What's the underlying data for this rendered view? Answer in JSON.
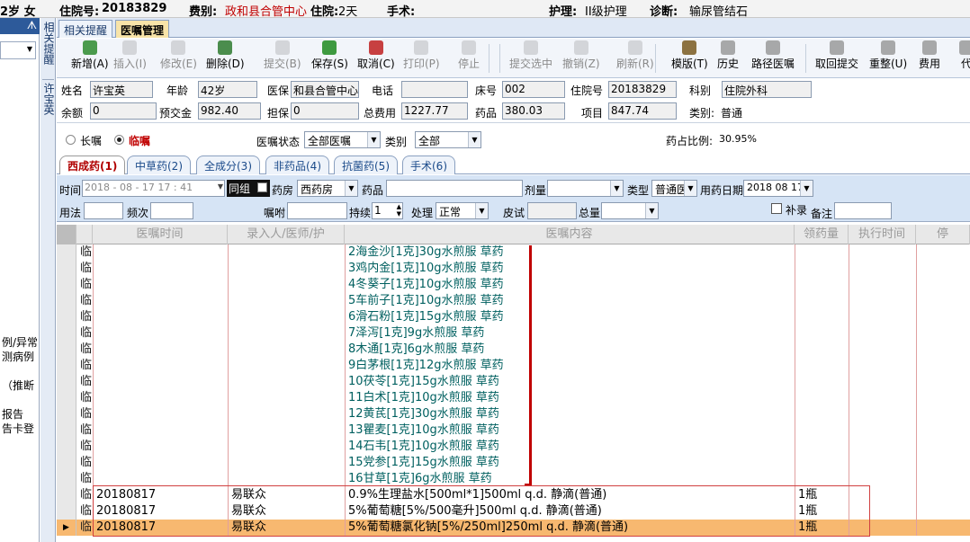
{
  "header": {
    "age_sex": "2岁  女",
    "admission_label": "住院号:",
    "admission_no": "20183829",
    "fee_label": "费别:",
    "fee_value": "政和县合管中心",
    "stay_label": "住院:",
    "stay_value": "2天",
    "surgery_label": "手术:",
    "nursing_label": "护理:",
    "nursing_value": "II级护理",
    "diag_label": "诊断:",
    "diag_value": "输尿管结石"
  },
  "left_panel": {
    "pin": "ᗑ",
    "items": [
      "例/异常",
      "测病例",
      "（推断",
      "报告",
      "告卡登"
    ]
  },
  "vertical_tabs": [
    "相关提醒",
    "许宝英"
  ],
  "top_tabs": [
    "相关提醒",
    "医嘱管理"
  ],
  "toolbar": [
    {
      "label": "新增(A)",
      "icon": "add-icon",
      "color": "#2e8b2e",
      "enabled": true
    },
    {
      "label": "插入(I)",
      "icon": "insert-icon",
      "color": "#9a9a9a",
      "enabled": false
    },
    {
      "label": "修改(E)",
      "icon": "edit-icon",
      "color": "#9a9a9a",
      "enabled": false
    },
    {
      "label": "删除(D)",
      "icon": "delete-icon",
      "color": "#2e7a2e",
      "enabled": true
    },
    {
      "label": "提交(B)",
      "icon": "submit-icon",
      "color": "#9a9a9a",
      "enabled": false
    },
    {
      "label": "保存(S)",
      "icon": "save-icon",
      "color": "#1e8a1e",
      "enabled": true
    },
    {
      "label": "取消(C)",
      "icon": "cancel-icon",
      "color": "#c02020",
      "enabled": true
    },
    {
      "label": "打印(P)",
      "icon": "print-icon",
      "color": "#9a9a9a",
      "enabled": false
    },
    {
      "label": "停止",
      "icon": "stop-icon",
      "color": "#9a9a9a",
      "enabled": false
    },
    {
      "label": "提交选中",
      "icon": "submit-selected-icon",
      "color": "#9a9a9a",
      "enabled": false
    },
    {
      "label": "撤销(Z)",
      "icon": "undo-icon",
      "color": "#9a9a9a",
      "enabled": false
    },
    {
      "label": "刷新(R)",
      "icon": "refresh-icon",
      "color": "#9a9a9a",
      "enabled": false
    },
    {
      "label": "模版(T)",
      "icon": "template-icon",
      "color": "#7a5a20",
      "enabled": true
    },
    {
      "label": "历史",
      "icon": "history-icon",
      "color": "#9a9a9a",
      "enabled": true
    },
    {
      "label": "路径医嘱",
      "icon": "path-order-icon",
      "color": "#9a9a9a",
      "enabled": true
    },
    {
      "label": "取回提交",
      "icon": "retrieve-icon",
      "color": "#9a9a9a",
      "enabled": true
    },
    {
      "label": "重整(U)",
      "icon": "reorganize-icon",
      "color": "#9a9a9a",
      "enabled": true
    },
    {
      "label": "费用",
      "icon": "fee-icon",
      "color": "#9a9a9a",
      "enabled": true
    },
    {
      "label": "代",
      "icon": "proxy-icon",
      "color": "#9a9a9a",
      "enabled": true
    }
  ],
  "patient": {
    "name_label": "姓名",
    "name": "许宝英",
    "age_label": "年龄",
    "age": "42岁",
    "ins_label": "医保",
    "ins": "和县合管中心",
    "phone_label": "电话",
    "phone": "",
    "bed_label": "床号",
    "bed": "002",
    "adm_label": "住院号",
    "adm": "20183829",
    "dept_label": "科别",
    "dept": "住院外科",
    "balance_label": "余额",
    "balance": "0",
    "deposit_label": "预交金",
    "deposit": "982.40",
    "guarantee_label": "担保",
    "guarantee": "0",
    "total_label": "总费用",
    "total": "1227.77",
    "drug_label": "药品",
    "drug": "380.03",
    "item_label": "项目",
    "item": "847.74",
    "category_label": "类别:",
    "category": "普通"
  },
  "filter": {
    "long_label": "长嘱",
    "temp_label": "临嘱",
    "status_label": "医嘱状态",
    "status_value": "全部医嘱",
    "type_label": "类别",
    "type_value": "全部",
    "ratio_label": "药占比例:",
    "ratio_value": "30.95%"
  },
  "drug_tabs": [
    "西成药(1)",
    "中草药(2)",
    "全成分(3)",
    "非药品(4)",
    "抗菌药(5)",
    "手术(6)"
  ],
  "entry": {
    "time_label": "时间",
    "time_value": "2018 - 08 - 17   17 : 41",
    "group_label": "同组",
    "pharmacy_label": "药房",
    "pharmacy_value": "西药房",
    "drug_label": "药品",
    "drug_value": "",
    "dose_label": "剂量",
    "dose_value": "",
    "type_label": "类型",
    "type_value": "普通医",
    "date_label": "用药日期",
    "date_value": "2018 08 17",
    "usage_label": "用法",
    "usage_value": "",
    "freq_label": "频次",
    "freq_value": "",
    "advice_label": "嘱咐",
    "advice_value": "",
    "duration_label": "持续",
    "duration_value": "1",
    "handle_label": "处理",
    "handle_value": "正常",
    "skin_label": "皮试",
    "skin_value": "",
    "total_label": "总量",
    "total_value": "",
    "supp_label": "补录",
    "note_label": "备注",
    "note_value": ""
  },
  "grid": {
    "columns": [
      "医嘱时间",
      "录入人/医师/护",
      "医嘱内容",
      "领药量",
      "执行时间",
      "停"
    ],
    "rows": [
      {
        "flag": "临",
        "time": "",
        "entered": "",
        "content": "2海金沙[1克]30g水煎服 草药",
        "qty": "",
        "herb": true
      },
      {
        "flag": "临",
        "time": "",
        "entered": "",
        "content": "3鸡内金[1克]10g水煎服 草药",
        "qty": "",
        "herb": true
      },
      {
        "flag": "临",
        "time": "",
        "entered": "",
        "content": "4冬葵子[1克]10g水煎服 草药",
        "qty": "",
        "herb": true
      },
      {
        "flag": "临",
        "time": "",
        "entered": "",
        "content": "5车前子[1克]10g水煎服 草药",
        "qty": "",
        "herb": true
      },
      {
        "flag": "临",
        "time": "",
        "entered": "",
        "content": "6滑石粉[1克]15g水煎服 草药",
        "qty": "",
        "herb": true
      },
      {
        "flag": "临",
        "time": "",
        "entered": "",
        "content": "7泽泻[1克]9g水煎服 草药",
        "qty": "",
        "herb": true
      },
      {
        "flag": "临",
        "time": "",
        "entered": "",
        "content": "8木通[1克]6g水煎服 草药",
        "qty": "",
        "herb": true
      },
      {
        "flag": "临",
        "time": "",
        "entered": "",
        "content": "9白茅根[1克]12g水煎服 草药",
        "qty": "",
        "herb": true
      },
      {
        "flag": "临",
        "time": "",
        "entered": "",
        "content": "10茯苓[1克]15g水煎服 草药",
        "qty": "",
        "herb": true
      },
      {
        "flag": "临",
        "time": "",
        "entered": "",
        "content": "11白术[1克]10g水煎服 草药",
        "qty": "",
        "herb": true
      },
      {
        "flag": "临",
        "time": "",
        "entered": "",
        "content": "12黄芪[1克]30g水煎服 草药",
        "qty": "",
        "herb": true
      },
      {
        "flag": "临",
        "time": "",
        "entered": "",
        "content": "13瞿麦[1克]10g水煎服 草药",
        "qty": "",
        "herb": true
      },
      {
        "flag": "临",
        "time": "",
        "entered": "",
        "content": "14石韦[1克]10g水煎服 草药",
        "qty": "",
        "herb": true
      },
      {
        "flag": "临",
        "time": "",
        "entered": "",
        "content": "15党参[1克]15g水煎服 草药",
        "qty": "",
        "herb": true
      },
      {
        "flag": "临",
        "time": "",
        "entered": "",
        "content": "16甘草[1克]6g水煎服 草药",
        "qty": "",
        "herb": true
      },
      {
        "flag": "临",
        "time": "20180817",
        "entered": "易联众",
        "content": "0.9%生理盐水[500ml*1]500ml q.d. 静滴(普通)",
        "qty": "1瓶",
        "herb": false
      },
      {
        "flag": "临",
        "time": "20180817",
        "entered": "易联众",
        "content": "5%葡萄糖[5%/500毫升]500ml q.d. 静滴(普通)",
        "qty": "1瓶",
        "herb": false
      },
      {
        "flag": "临",
        "time": "20180817",
        "entered": "易联众",
        "content": "5%葡萄糖氯化钠[5%/250ml]250ml q.d. 静滴(普通)",
        "qty": "1瓶",
        "herb": false,
        "selected": true
      }
    ]
  },
  "colors": {
    "accent": "#2d5a9a",
    "selected_row": "#f7b870",
    "herb_text": "#006060",
    "temp_red": "#c00000"
  }
}
